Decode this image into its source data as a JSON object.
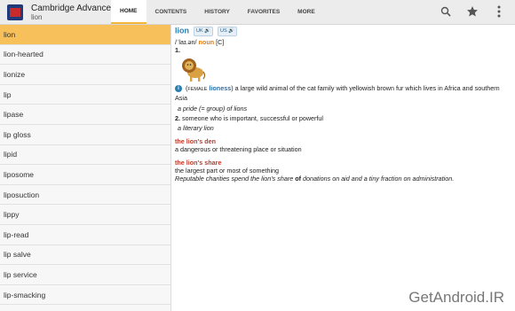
{
  "app": {
    "title": "Cambridge Advanced",
    "subtitle": "lion"
  },
  "tabs": [
    {
      "label": "HOME"
    },
    {
      "label": "CONTENTS"
    },
    {
      "label": "HISTORY"
    },
    {
      "label": "FAVORITES"
    },
    {
      "label": "MORE"
    }
  ],
  "icons": {
    "search": "search-icon",
    "favorite": "star-icon",
    "menu": "more-vert-icon"
  },
  "word_list": [
    {
      "label": "lion"
    },
    {
      "label": "lion-hearted"
    },
    {
      "label": "lionize"
    },
    {
      "label": "lip"
    },
    {
      "label": "lipase"
    },
    {
      "label": "lip gloss"
    },
    {
      "label": "lipid"
    },
    {
      "label": "liposome"
    },
    {
      "label": "liposuction"
    },
    {
      "label": "lippy"
    },
    {
      "label": "lip-read"
    },
    {
      "label": "lip salve"
    },
    {
      "label": "lip service"
    },
    {
      "label": "lip-smacking"
    }
  ],
  "entry": {
    "headword": "lion",
    "uk_label": "UK",
    "us_label": "US",
    "pronunciation": "/ˈlaɪ.ən/",
    "pos": "noun",
    "grammar": "[C]",
    "sense1_num": "1.",
    "alt_paren_open": "(",
    "alt_label": "FEMALE",
    "alt_word": "lioness",
    "alt_paren_close": ")",
    "definition1": "a large wild animal of the cat family with yellowish brown fur which lives in Africa and southern Asia",
    "example1": "a pride (= group) of lions",
    "sense2_num": "2.",
    "definition2": "someone who is important, successful or powerful",
    "example2": "a literary lion",
    "phrase1": "the lion's den",
    "phrase1_def": "a dangerous or threatening place or situation",
    "phrase2": "the lion's share",
    "phrase2_def": "the largest part or most of something",
    "phrase2_example_a": "Reputable charities spend the lion's share ",
    "phrase2_example_b": "of",
    "phrase2_example_c": " donations on aid and a tiny fraction on administration."
  },
  "watermark": "GetAndroid.IR"
}
